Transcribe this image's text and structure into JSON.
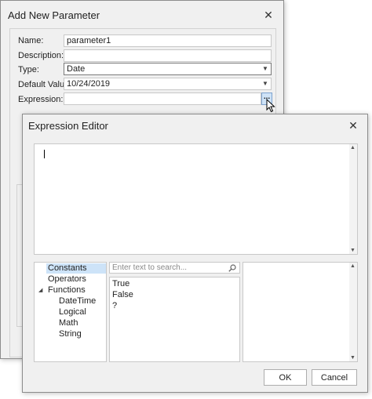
{
  "param_dialog": {
    "title": "Add New Parameter",
    "close_glyph": "✕",
    "labels": {
      "name": "Name:",
      "description": "Description:",
      "type": "Type:",
      "default_value": "Default Value:",
      "expression": "Expression:"
    },
    "values": {
      "name": "parameter1",
      "description": "",
      "type": "Date",
      "default_value": "10/24/2019",
      "expression": ""
    },
    "ellipsis": "..."
  },
  "expr_dialog": {
    "title": "Expression Editor",
    "close_glyph": "✕",
    "tree": {
      "constants": "Constants",
      "operators": "Operators",
      "functions": "Functions",
      "datetime": "DateTime",
      "logical": "Logical",
      "math": "Math",
      "string": "String"
    },
    "search_placeholder": "Enter text to search...",
    "items": [
      "True",
      "False",
      "?"
    ],
    "ok_label": "OK",
    "cancel_label": "Cancel"
  },
  "icons": {
    "dropdown": "chevron-down-icon",
    "search": "search-icon",
    "expand": "expand-triangle-icon",
    "close": "close-icon",
    "cursor": "mouse-pointer-icon"
  }
}
